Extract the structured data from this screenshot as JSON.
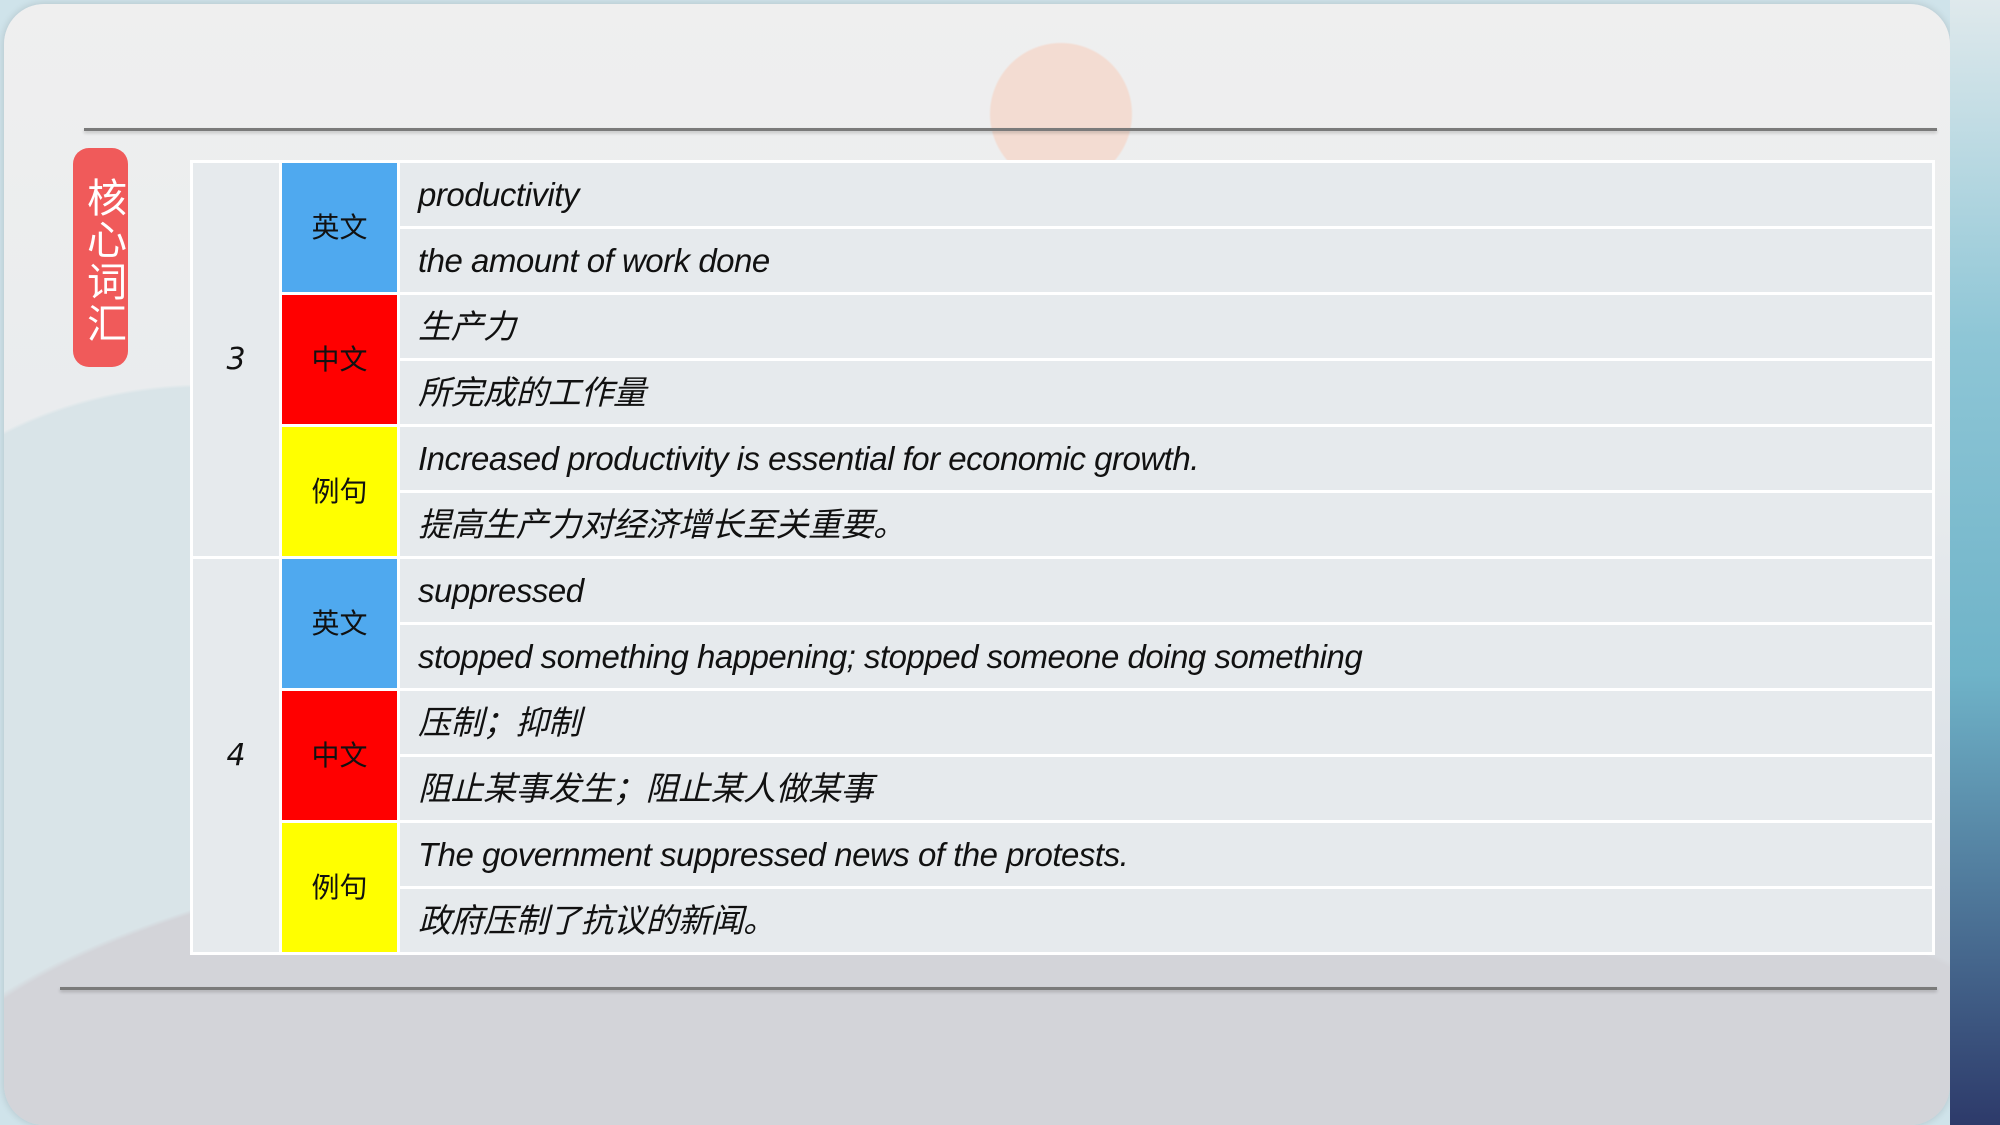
{
  "badge": "核心词汇",
  "colors": {
    "english": "#4fa9ef",
    "chinese": "#ff0000",
    "example": "#ffff00",
    "badge": "#f05a5a"
  },
  "entries": [
    {
      "number": "3",
      "english_label": "英文",
      "word": "productivity",
      "definition": "the amount of work done",
      "chinese_label": "中文",
      "cn_word": "生产力",
      "cn_definition": "所完成的工作量",
      "example_label": "例句",
      "example_en": "Increased productivity is essential for economic growth.",
      "example_cn": "提高生产力对经济增长至关重要。"
    },
    {
      "number": "4",
      "english_label": "英文",
      "word": "suppressed",
      "definition": "stopped something happening; stopped someone doing something",
      "chinese_label": "中文",
      "cn_word": "压制；抑制",
      "cn_definition": "阻止某事发生；阻止某人做某事",
      "example_label": "例句",
      "example_en": "The government suppressed news of the protests.",
      "example_cn": "政府压制了抗议的新闻。"
    }
  ]
}
